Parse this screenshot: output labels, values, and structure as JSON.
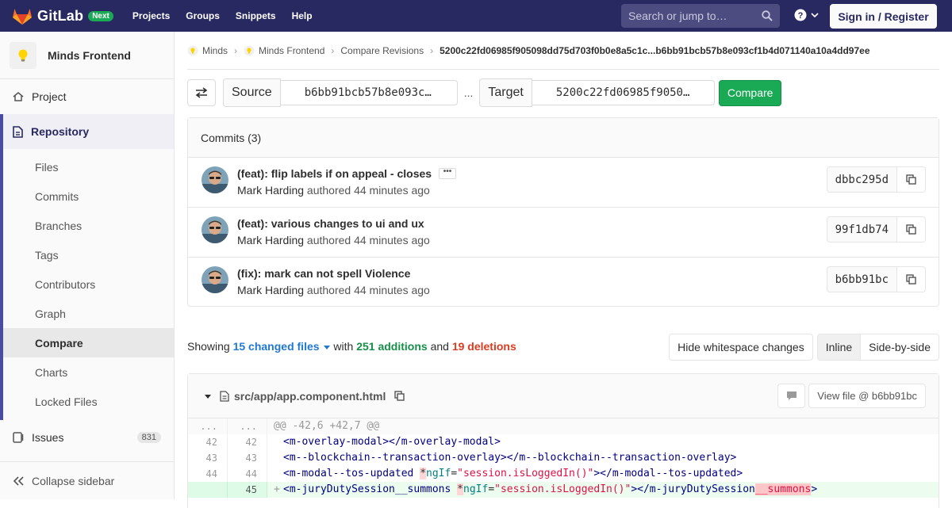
{
  "topbar": {
    "brand": "GitLab",
    "badge": "Next",
    "nav": [
      "Projects",
      "Groups",
      "Snippets",
      "Help"
    ],
    "search_placeholder": "Search or jump to…",
    "signin": "Sign in / Register",
    "bg_color": "#292961"
  },
  "sidebar": {
    "project_name": "Minds Frontend",
    "project": "Project",
    "repository": "Repository",
    "sub_items": [
      "Files",
      "Commits",
      "Branches",
      "Tags",
      "Contributors",
      "Graph",
      "Compare",
      "Charts",
      "Locked Files"
    ],
    "active_item": "Compare",
    "issues": "Issues",
    "issues_count": "831",
    "collapse": "Collapse sidebar"
  },
  "breadcrumb": {
    "items": [
      "Minds",
      "Minds Frontend",
      "Compare Revisions"
    ],
    "current": "5200c22fd06985f905098dd75d703f0b0e8a5c1c...b6bb91bcb57b8e093cf1b4d071140a10a4dd97ee"
  },
  "compare": {
    "source_label": "Source",
    "source_ref": "b6bb91bcb57b8e093c…",
    "separator": "...",
    "target_label": "Target",
    "target_ref": "5200c22fd06985f9050…",
    "button": "Compare"
  },
  "commits": {
    "header": "Commits (3)",
    "items": [
      {
        "title": "(feat): flip labels if on appeal - closes",
        "author": "Mark Harding",
        "time": "authored 44 minutes ago",
        "sha": "dbbc295d",
        "has_ellipsis": true
      },
      {
        "title": "(feat): various changes to ui and ux",
        "author": "Mark Harding",
        "time": "authored 44 minutes ago",
        "sha": "99f1db74"
      },
      {
        "title": "(fix): mark can not spell Violence",
        "author": "Mark Harding",
        "time": "authored 44 minutes ago",
        "sha": "b6bb91bc"
      }
    ]
  },
  "summary": {
    "prefix": "Showing",
    "files": "15 changed files",
    "with": "with",
    "additions": "251 additions",
    "and": "and",
    "deletions": "19 deletions"
  },
  "view_buttons": {
    "whitespace": "Hide whitespace changes",
    "inline": "Inline",
    "side_by_side": "Side-by-side"
  },
  "file": {
    "path": "src/app/app.component.html",
    "view_file": "View file @ b6bb91bc",
    "lines": [
      {
        "old": "...",
        "new": "...",
        "type": "match",
        "text": "@@ -42,6 +42,7 @@"
      },
      {
        "old": "42",
        "new": "42",
        "type": "context"
      },
      {
        "old": "43",
        "new": "43",
        "type": "context"
      },
      {
        "old": "44",
        "new": "44",
        "type": "context"
      },
      {
        "old": "",
        "new": "45",
        "type": "add",
        "sign": "+"
      }
    ]
  },
  "colors": {
    "accent": "#1aaa55",
    "link": "#1f78d1",
    "additions": "#168f48",
    "deletions": "#db3b21"
  }
}
